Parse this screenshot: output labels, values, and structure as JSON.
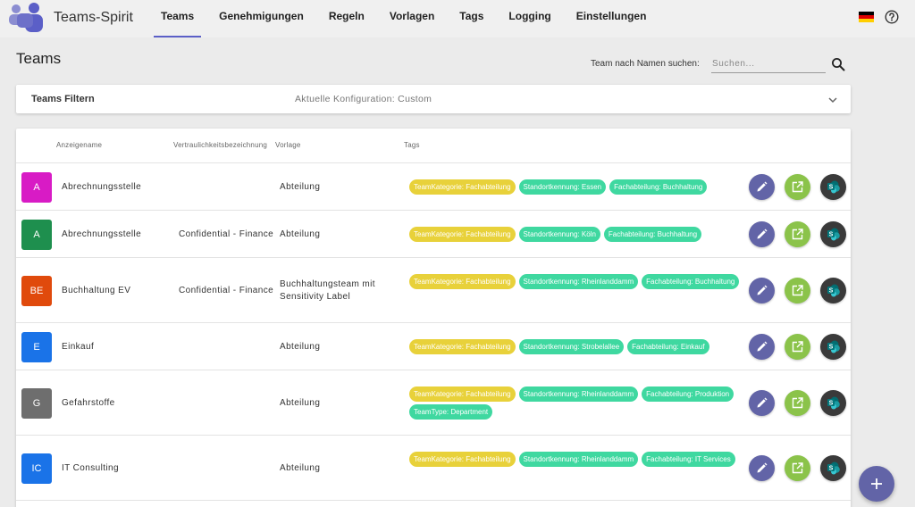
{
  "app": {
    "title": "Teams-Spirit"
  },
  "nav": [
    "Teams",
    "Genehmigungen",
    "Regeln",
    "Vorlagen",
    "Tags",
    "Logging",
    "Einstellungen"
  ],
  "nav_active": "Teams",
  "page": {
    "title": "Teams"
  },
  "search": {
    "label": "Team nach Namen suchen:",
    "placeholder": "Suchen..."
  },
  "filter": {
    "title": "Teams Filtern",
    "config": "Aktuelle Konfiguration: Custom"
  },
  "table": {
    "headers": {
      "name": "Anzeigename",
      "label": "Vertraulichkeitsbezeichnung",
      "template": "Vorlage",
      "tags": "Tags"
    },
    "rows": [
      {
        "initials": "A",
        "color": "#d81bc5",
        "name": "Abrechnungsstelle",
        "label": "",
        "template": "Abteilung",
        "tags": [
          {
            "text": "TeamKategorie: Fachabteilung",
            "kind": "yellow"
          },
          {
            "text": "Standortkennung: Essen",
            "kind": "green"
          },
          {
            "text": "Fachabteilung: Buchhaltung",
            "kind": "green"
          }
        ]
      },
      {
        "initials": "A",
        "color": "#1e8f4e",
        "name": "Abrechnungsstelle",
        "label": "Confidential - Finance",
        "template": "Abteilung",
        "tags": [
          {
            "text": "TeamKategorie: Fachabteilung",
            "kind": "yellow"
          },
          {
            "text": "Standortkennung: Köln",
            "kind": "green"
          },
          {
            "text": "Fachabteilung: Buchhaltung",
            "kind": "green"
          }
        ]
      },
      {
        "initials": "BE",
        "color": "#e04a0c",
        "name": "Buchhaltung EV",
        "label": "Confidential - Finance",
        "template": "Buchhaltungsteam mit Sensitivity Label",
        "tags": [
          {
            "text": "TeamKategorie: Fachabteilung",
            "kind": "yellow"
          },
          {
            "text": "Standortkennung: Rheinlanddamm",
            "kind": "green"
          },
          {
            "text": "Fachabteilung: Buchhaltung",
            "kind": "green"
          }
        ]
      },
      {
        "initials": "E",
        "color": "#1a73e8",
        "name": "Einkauf",
        "label": "",
        "template": "Abteilung",
        "tags": [
          {
            "text": "TeamKategorie: Fachabteilung",
            "kind": "yellow"
          },
          {
            "text": "Standortkennung: Strobelallee",
            "kind": "green"
          },
          {
            "text": "Fachabteilung: Einkauf",
            "kind": "green"
          }
        ]
      },
      {
        "initials": "G",
        "color": "#6e6e6e",
        "name": "Gefahrstoffe",
        "label": "",
        "template": "Abteilung",
        "tags": [
          {
            "text": "TeamKategorie: Fachabteilung",
            "kind": "yellow"
          },
          {
            "text": "Standortkennung: Rheinlanddamm",
            "kind": "green"
          },
          {
            "text": "Fachabteilung: Produktion",
            "kind": "green"
          },
          {
            "text": "TeamType: Department",
            "kind": "green"
          }
        ]
      },
      {
        "initials": "IC",
        "color": "#1a73e8",
        "name": "IT Consulting",
        "label": "",
        "template": "Abteilung",
        "tags": [
          {
            "text": "TeamKategorie: Fachabteilung",
            "kind": "yellow"
          },
          {
            "text": "Standortkennung: Rheinlanddamm",
            "kind": "green"
          },
          {
            "text": "Fachabteilung: IT Services",
            "kind": "green"
          }
        ]
      }
    ]
  },
  "colors": {
    "accent": "#6264a7",
    "open": "#8bc34a",
    "tag_yellow": "#e8d13a",
    "tag_green": "#3fd8a0"
  }
}
